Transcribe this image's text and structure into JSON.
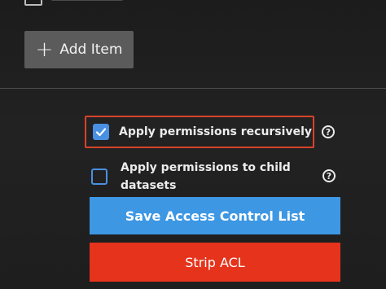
{
  "toolbar": {
    "add_item_label": "Add Item"
  },
  "options": {
    "recursive": {
      "label": "Apply permissions recursively",
      "checked": true,
      "help_icon": "question-circle-icon"
    },
    "child_datasets": {
      "label": "Apply permissions to child datasets",
      "checked": false,
      "help_icon": "question-circle-icon"
    }
  },
  "actions": {
    "save_label": "Save Access Control List",
    "strip_label": "Strip ACL"
  },
  "colors": {
    "accent_blue": "#3d97e3",
    "danger_red": "#e5331c",
    "highlight_outline": "#d8432a"
  },
  "icons": {
    "add": "plus-icon",
    "check": "check-icon",
    "help": "question-circle-icon"
  }
}
